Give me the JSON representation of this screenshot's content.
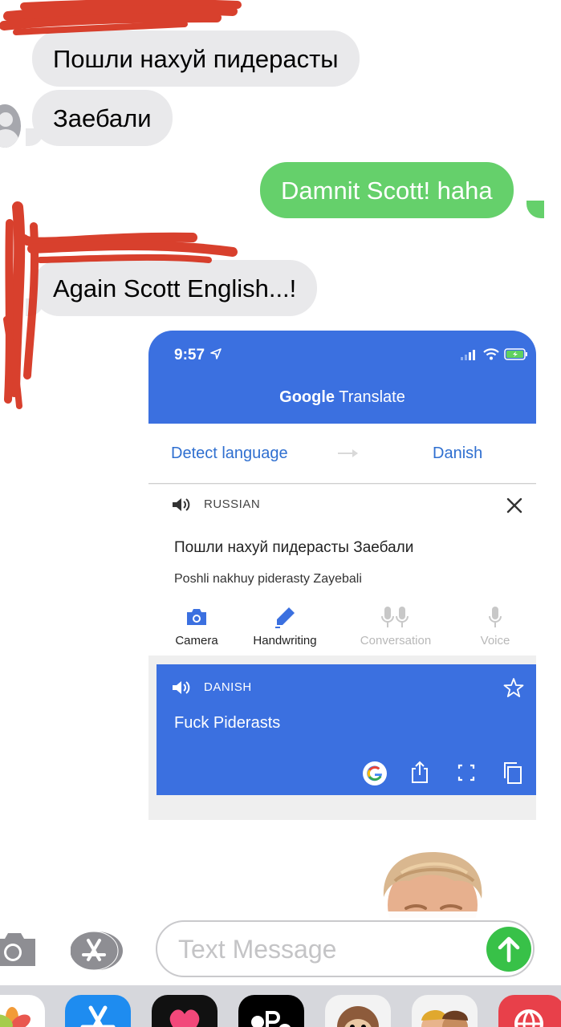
{
  "thread": {
    "incoming_1": "Пошли нахуй  пидерасты",
    "incoming_2": "Заебали",
    "outgoing_1": "Damnit Scott! haha",
    "incoming_3": "Again Scott English...!"
  },
  "translate_screenshot": {
    "status_time": "9:57",
    "app_title_brand": "Google",
    "app_title_product": " Translate",
    "source_language": "Detect language",
    "target_language": "Danish",
    "detected_language": "RUSSIAN",
    "source_text": "Пошли нахуй пидерасты Заебали",
    "transliteration": "Poshli nakhuy piderasty Zayebali",
    "tools": [
      "Camera",
      "Handwriting",
      "Conversation",
      "Voice"
    ],
    "output_language": "DANISH",
    "output_text": "Fuck Piderasts",
    "colors": {
      "header": "#3b70e0",
      "link": "#2f6fd0"
    }
  },
  "composer": {
    "placeholder": "Text Message"
  },
  "app_drawer": [
    "photos-app",
    "app-store-app",
    "digital-touch-app",
    "apple-pay-app",
    "animoji-app",
    "memoji-app",
    "web-search-app"
  ],
  "colors": {
    "incoming_bubble": "#e9e9eb",
    "outgoing_bubble": "#65d06b",
    "send": "#38c148",
    "scribble": "#d5301c"
  }
}
